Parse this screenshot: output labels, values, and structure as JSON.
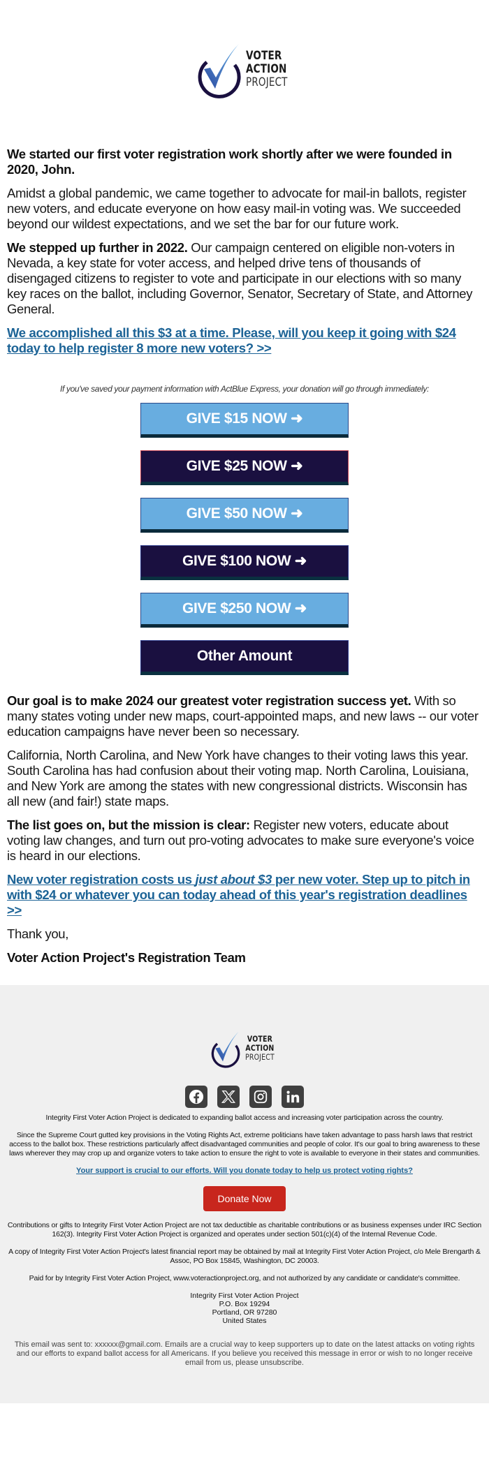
{
  "brand": {
    "line1": "VOTER",
    "line2": "ACTION",
    "line3": "PROJECT",
    "colors": {
      "navy": "#1a1040",
      "blue": "#68ade0",
      "link": "#1c6396",
      "donate_red": "#c8261d",
      "footer_bg": "#f0f0f0"
    }
  },
  "email": {
    "p1_bold": "We started our first voter registration work shortly after we were founded in 2020, John.",
    "p2": "Amidst a global pandemic, we came together to advocate for mail-in ballots, register new voters, and educate everyone on how easy mail-in voting was. We succeeded beyond our wildest expectations, and we set the bar for our future work.",
    "p3_bold": "We stepped up further in 2022.",
    "p3_rest": " Our campaign centered on eligible non-voters in Nevada, a key state for voter access, and helped drive tens of thousands of disengaged citizens to register to vote and participate in our elections with so many key races on the ballot, including Governor, Senator, Secretary of State, and Attorney General.",
    "cta1": "We accomplished all this $3 at a time. Please, will you keep it going with $24 today to help register 8 more new voters? >>",
    "actblue_note": "If you've saved your payment information with ActBlue Express, your donation will go through immediately:",
    "buttons": [
      {
        "label": "GIVE $15 NOW ➜",
        "style": "light"
      },
      {
        "label": "GIVE $25 NOW ➜",
        "style": "dark"
      },
      {
        "label": "GIVE $50 NOW ➜",
        "style": "light"
      },
      {
        "label": "GIVE $100 NOW ➜",
        "style": "dark"
      },
      {
        "label": "GIVE $250 NOW ➜",
        "style": "light"
      },
      {
        "label": "Other Amount",
        "style": "dark"
      }
    ],
    "p4_bold": "Our goal is to make 2024 our greatest voter registration success yet.",
    "p4_rest": " With so many states voting under new maps, court-appointed maps, and new laws -- our voter education campaigns have never been so necessary.",
    "p5": "California, North Carolina, and New York have changes to their voting laws this year. South Carolina has had confusion about their voting map. North Carolina, Louisiana, and New York are among the states with new congressional districts. Wisconsin has all new (and fair!) state maps.",
    "p6_bold": "The list goes on, but the mission is clear:",
    "p6_rest": " Register new voters, educate about voting law changes, and turn out pro-voting advocates to make sure everyone's voice is heard in our elections.",
    "cta2_a": "New voter registration costs us ",
    "cta2_italic": "just about $3",
    "cta2_b": " per new voter. Step up to pitch in with $24 or whatever you can today ahead of this year's registration deadlines >>",
    "signoff": "Thank you,",
    "signature": "Voter Action Project's Registration Team"
  },
  "footer": {
    "social": [
      "facebook",
      "x",
      "instagram",
      "linkedin"
    ],
    "mission": "Integrity First Voter Action Project is dedicated to expanding ballot access and increasing voter participation across the country.",
    "about": "Since the Supreme Court gutted key provisions in the Voting Rights Act, extreme politicians have taken advantage to pass harsh laws that restrict access to the ballot box. These restrictions particularly affect disadvantaged communities and people of color. It's our goal to bring awareness to these laws wherever they may crop up and organize voters to take action to ensure the right to vote is available to everyone in their states and communities.",
    "support_link": "Your support is crucial to our efforts. Will you donate today to help us protect voting rights?",
    "donate_label": "Donate Now",
    "tax": "Contributions or gifts to Integrity First Voter Action Project are not tax deductible as charitable contributions or as business expenses under IRC Section 162(3). Integrity First Voter Action Project is organized and operates under section 501(c)(4) of the Internal Revenue Code.",
    "report": "A copy of Integrity First Voter Action Project's latest financial report may be obtained by mail at Integrity First Voter Action Project, c/o Mele Brengarth & Assoc, PO Box 15845, Washington, DC 20003.",
    "paid_for": "Paid for by Integrity First Voter Action Project, www.voteractionproject.org, and not authorized by any candidate or candidate's committee.",
    "address": [
      "Integrity First Voter Action Project",
      "P.O. Box 19294",
      "Portland, OR 97280",
      "United States"
    ],
    "sent_to": "This email was sent to: xxxxxx@gmail.com. Emails are a crucial way to keep supporters up to date on the latest attacks on voting rights and our efforts to expand ballot access for all Americans. If you believe you received this message in error or wish to no longer receive email from us, please unsubscribe."
  }
}
